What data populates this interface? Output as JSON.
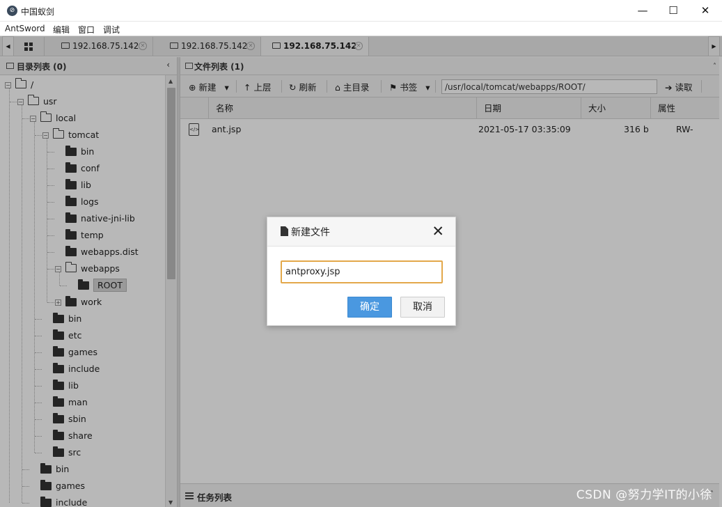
{
  "window": {
    "title": "中国蚁剑",
    "app_icon_glyph": "⊘",
    "controls": {
      "minimize": "—",
      "maximize": "☐",
      "close": "✕"
    }
  },
  "menu": [
    "AntSword",
    "编辑",
    "窗口",
    "调试"
  ],
  "tabs": [
    {
      "label": "192.168.75.142",
      "active": false
    },
    {
      "label": "192.168.75.142",
      "active": false
    },
    {
      "label": "192.168.75.142",
      "active": true
    }
  ],
  "tab_nav": {
    "left": "◀",
    "right": "▶"
  },
  "left_panel": {
    "title": "目录列表 (0)",
    "collapse_glyph": "‹",
    "tree": [
      {
        "label": "/",
        "depth": 0,
        "toggle": "−",
        "folder": "open"
      },
      {
        "label": "usr",
        "depth": 1,
        "toggle": "−",
        "folder": "open"
      },
      {
        "label": "local",
        "depth": 2,
        "toggle": "−",
        "folder": "open"
      },
      {
        "label": "tomcat",
        "depth": 3,
        "toggle": "−",
        "folder": "open"
      },
      {
        "label": "bin",
        "depth": 4,
        "toggle": "",
        "folder": "closed"
      },
      {
        "label": "conf",
        "depth": 4,
        "toggle": "",
        "folder": "closed"
      },
      {
        "label": "lib",
        "depth": 4,
        "toggle": "",
        "folder": "closed"
      },
      {
        "label": "logs",
        "depth": 4,
        "toggle": "",
        "folder": "closed"
      },
      {
        "label": "native-jni-lib",
        "depth": 4,
        "toggle": "",
        "folder": "closed"
      },
      {
        "label": "temp",
        "depth": 4,
        "toggle": "",
        "folder": "closed"
      },
      {
        "label": "webapps.dist",
        "depth": 4,
        "toggle": "",
        "folder": "closed"
      },
      {
        "label": "webapps",
        "depth": 4,
        "toggle": "−",
        "folder": "open"
      },
      {
        "label": "ROOT",
        "depth": 5,
        "toggle": "",
        "folder": "closed",
        "selected": true
      },
      {
        "label": "work",
        "depth": 4,
        "toggle": "+",
        "folder": "closed"
      },
      {
        "label": "bin",
        "depth": 3,
        "toggle": "",
        "folder": "closed"
      },
      {
        "label": "etc",
        "depth": 3,
        "toggle": "",
        "folder": "closed"
      },
      {
        "label": "games",
        "depth": 3,
        "toggle": "",
        "folder": "closed"
      },
      {
        "label": "include",
        "depth": 3,
        "toggle": "",
        "folder": "closed"
      },
      {
        "label": "lib",
        "depth": 3,
        "toggle": "",
        "folder": "closed"
      },
      {
        "label": "man",
        "depth": 3,
        "toggle": "",
        "folder": "closed"
      },
      {
        "label": "sbin",
        "depth": 3,
        "toggle": "",
        "folder": "closed"
      },
      {
        "label": "share",
        "depth": 3,
        "toggle": "",
        "folder": "closed"
      },
      {
        "label": "src",
        "depth": 3,
        "toggle": "",
        "folder": "closed"
      },
      {
        "label": "bin",
        "depth": 2,
        "toggle": "",
        "folder": "closed"
      },
      {
        "label": "games",
        "depth": 2,
        "toggle": "",
        "folder": "closed"
      },
      {
        "label": "include",
        "depth": 2,
        "toggle": "",
        "folder": "closed"
      }
    ]
  },
  "right_panel": {
    "title": "文件列表 (1)",
    "toolbar": {
      "new": "新建",
      "up": "上层",
      "refresh": "刷新",
      "home": "主目录",
      "bookmark": "书签",
      "path": "/usr/local/tomcat/webapps/ROOT/",
      "read": "读取",
      "icons": {
        "new": "⊕",
        "up": "↑",
        "refresh": "↻",
        "home": "⌂",
        "bookmark": "⚑",
        "read": "➔",
        "caret": "▾"
      }
    },
    "columns": [
      "名称",
      "日期",
      "大小",
      "属性"
    ],
    "files": [
      {
        "name": "ant.jsp",
        "date": "2021-05-17 03:35:09",
        "size": "316 b",
        "attr": "RW-",
        "icon_glyph": "</>"
      }
    ],
    "tasks_title": "任务列表",
    "expand_glyph": "˄"
  },
  "dialog": {
    "title": "新建文件",
    "close": "✕",
    "input_value": "antproxy.jsp",
    "ok": "确定",
    "cancel": "取消"
  },
  "watermark": "CSDN @努力学IT的小徐",
  "colors": {
    "accent_blue": "#4a98e0",
    "input_focus": "#e3a84a"
  }
}
